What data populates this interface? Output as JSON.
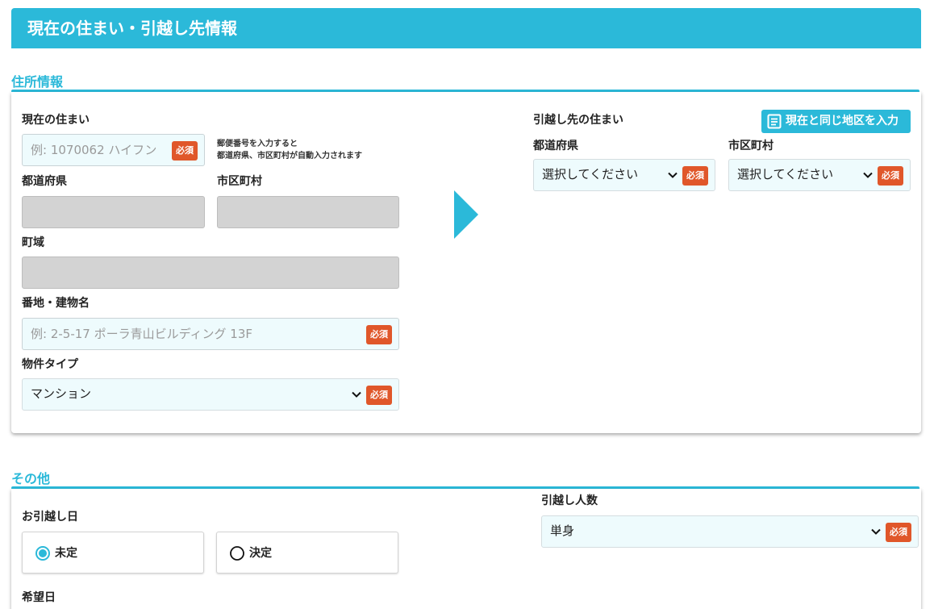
{
  "header": {
    "title": "現在の住まい・引越し先情報"
  },
  "address_section": {
    "title": "住所情報",
    "current": {
      "heading": "現在の住まい",
      "postal_placeholder": "例: 1070062 ハイフン",
      "postal_hint_line1": "郵便番号を入力すると",
      "postal_hint_line2": "都道府県、市区町村が自動入力されます",
      "prefecture_label": "都道府県",
      "city_label": "市区町村",
      "town_label": "町域",
      "street_label": "番地・建物名",
      "street_placeholder": "例: 2-5-17 ポーラ青山ビルディング 13F",
      "property_type_label": "物件タイプ",
      "property_type_value": "マンション"
    },
    "destination": {
      "heading": "引越し先の住まい",
      "same_area_button": "現在と同じ地区を入力",
      "prefecture_label": "都道府県",
      "prefecture_value": "選択してください",
      "city_label": "市区町村",
      "city_value": "選択してください"
    }
  },
  "other_section": {
    "title": "その他",
    "move_date_label": "お引越し日",
    "options": [
      {
        "label": "未定",
        "selected": true
      },
      {
        "label": "決定",
        "selected": false
      }
    ],
    "desired_date_label": "希望日",
    "people_label": "引越し人数",
    "people_value": "単身"
  },
  "required_badge": "必須",
  "colors": {
    "accent": "#2bb9d9",
    "required": "#e0572a",
    "field_bg": "#eefbfd",
    "disabled_bg": "#d3d3d3"
  },
  "icons": [
    "chevron-down-icon",
    "document-icon",
    "arrow-right-icon",
    "radio-icon"
  ]
}
